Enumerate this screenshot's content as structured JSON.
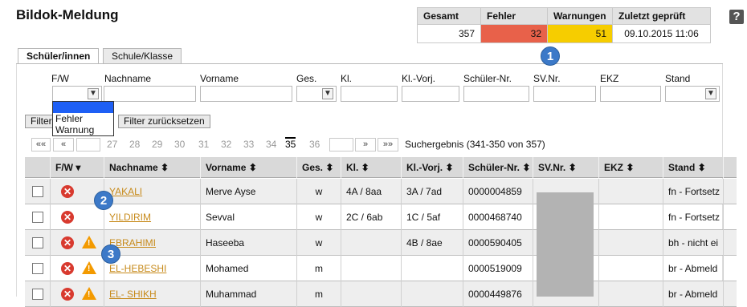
{
  "page_title": "Bildok-Meldung",
  "help_label": "?",
  "summary": {
    "headers": [
      "Gesamt",
      "Fehler",
      "Warnungen",
      "Zuletzt geprüft"
    ],
    "values": [
      "357",
      "32",
      "51",
      "09.10.2015 11:06"
    ],
    "colors": {
      "fehler": "#e8614a",
      "warnungen": "#f6cd00"
    }
  },
  "tabs": [
    {
      "label": "Schüler/innen",
      "active": true
    },
    {
      "label": "Schule/Klasse",
      "active": false
    }
  ],
  "filter": {
    "labels": [
      "F/W",
      "Nachname",
      "Vorname",
      "Ges.",
      "Kl.",
      "Kl.-Vorj.",
      "Schüler-Nr.",
      "SV.Nr.",
      "EKZ",
      "Stand"
    ],
    "fw_options": [
      "",
      "Fehler",
      "Warnung"
    ],
    "filter_button": "Filter",
    "reset_button": "Filter zurücksetzen"
  },
  "pager": {
    "first": "««",
    "prev": "«",
    "next": "»",
    "last": "»»",
    "pages": [
      "27",
      "28",
      "29",
      "30",
      "31",
      "32",
      "33",
      "34",
      "35",
      "36"
    ],
    "current": "35",
    "result_text": "Suchergebnis (341-350 von 357)"
  },
  "grid": {
    "headers": [
      "F/W ▾",
      "Nachname ⬍",
      "Vorname ⬍",
      "Ges. ⬍",
      "Kl. ⬍",
      "Kl.-Vorj. ⬍",
      "Schüler-Nr. ⬍",
      "SV.Nr. ⬍",
      "EKZ ⬍",
      "Stand ⬍"
    ],
    "rows": [
      {
        "error": true,
        "warning": false,
        "nachname": "YAKALI",
        "vorname": "Merve Ayse",
        "ges": "w",
        "kl": "4A / 8aa",
        "kl_vorj": "3A / 7ad",
        "schueler_nr": "0000004859",
        "stand": "fn - Fortsetz"
      },
      {
        "error": true,
        "warning": false,
        "nachname": "YILDIRIM",
        "vorname": "Sevval",
        "ges": "w",
        "kl": "2C / 6ab",
        "kl_vorj": "1C / 5af",
        "schueler_nr": "0000468740",
        "stand": "fn - Fortsetz"
      },
      {
        "error": true,
        "warning": true,
        "nachname": "EBRAHIMI",
        "vorname": "Haseeba",
        "ges": "w",
        "kl": "",
        "kl_vorj": "4B / 8ae",
        "schueler_nr": "0000590405",
        "stand": "bh - nicht ei"
      },
      {
        "error": true,
        "warning": true,
        "nachname": "EL-HEBESHI",
        "vorname": "Mohamed",
        "ges": "m",
        "kl": "",
        "kl_vorj": "",
        "schueler_nr": "0000519009",
        "stand": "br - Abmeld"
      },
      {
        "error": true,
        "warning": true,
        "nachname": "EL- SHIKH",
        "vorname": "Muhammad",
        "ges": "m",
        "kl": "",
        "kl_vorj": "",
        "schueler_nr": "0000449876",
        "stand": "br - Abmeld"
      }
    ]
  },
  "callouts": [
    "1",
    "2",
    "3"
  ],
  "icons": {
    "error": "x-circle-icon",
    "warning": "warning-triangle-icon"
  }
}
